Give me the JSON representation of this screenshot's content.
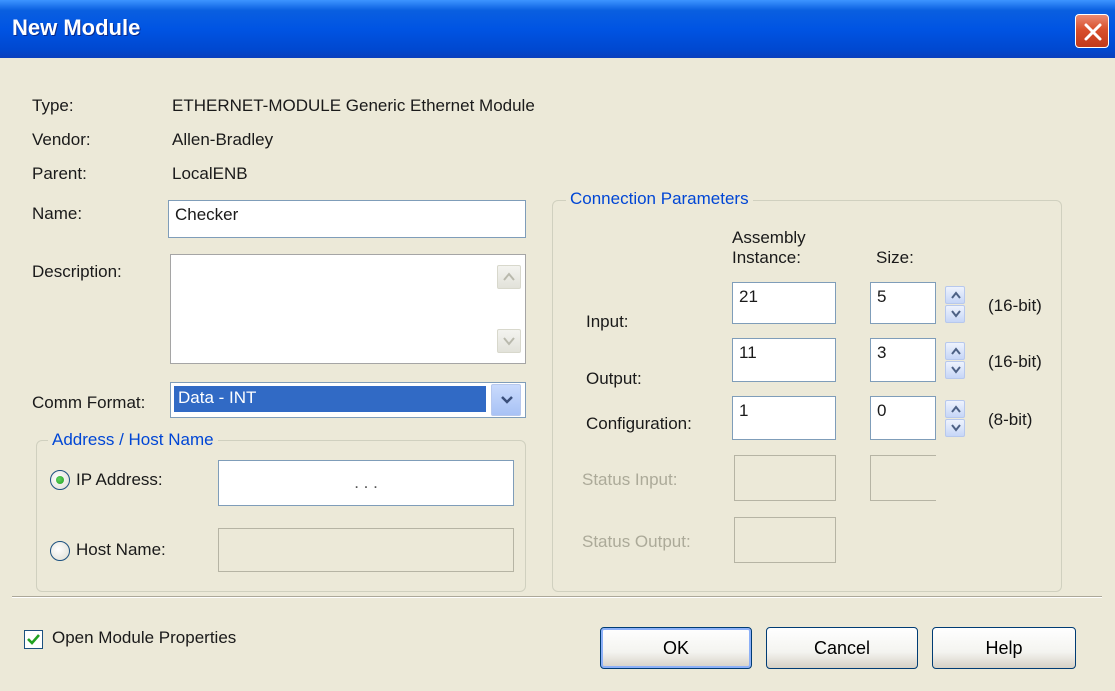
{
  "window": {
    "title": "New Module"
  },
  "info": {
    "type_label": "Type:",
    "type_value": "ETHERNET-MODULE Generic Ethernet Module",
    "vendor_label": "Vendor:",
    "vendor_value": "Allen-Bradley",
    "parent_label": "Parent:",
    "parent_value": "LocalENB"
  },
  "form": {
    "name_label": "Name:",
    "name_value": "Checker",
    "description_label": "Description:",
    "description_value": "",
    "comm_format_label": "Comm Format:",
    "comm_format_value": "Data - INT"
  },
  "address": {
    "legend": "Address / Host Name",
    "ip_label": "IP Address:",
    "ip_value": ".       .       .",
    "ip_selected": true,
    "host_label": "Host Name:",
    "host_value": ""
  },
  "connection": {
    "legend": "Connection Parameters",
    "col_assembly": "Assembly Instance:",
    "col_assembly_line1": "Assembly",
    "col_assembly_line2": "Instance:",
    "col_size": "Size:",
    "rows": [
      {
        "label": "Input:",
        "instance": "21",
        "size": "5",
        "unit": "(16-bit)"
      },
      {
        "label": "Output:",
        "instance": "11",
        "size": "3",
        "unit": "(16-bit)"
      },
      {
        "label": "Configuration:",
        "instance": "1",
        "size": "0",
        "unit": "(8-bit)"
      }
    ],
    "status_input_label": "Status Input:",
    "status_output_label": "Status Output:"
  },
  "footer": {
    "open_props_label": "Open Module Properties",
    "open_props_checked": true,
    "ok_label": "OK",
    "cancel_label": "Cancel",
    "help_label": "Help"
  },
  "colors": {
    "titlebar": "#0054e3",
    "dialog_bg": "#ece9d8",
    "group_legend": "#0046d5",
    "selection": "#316ac5"
  }
}
